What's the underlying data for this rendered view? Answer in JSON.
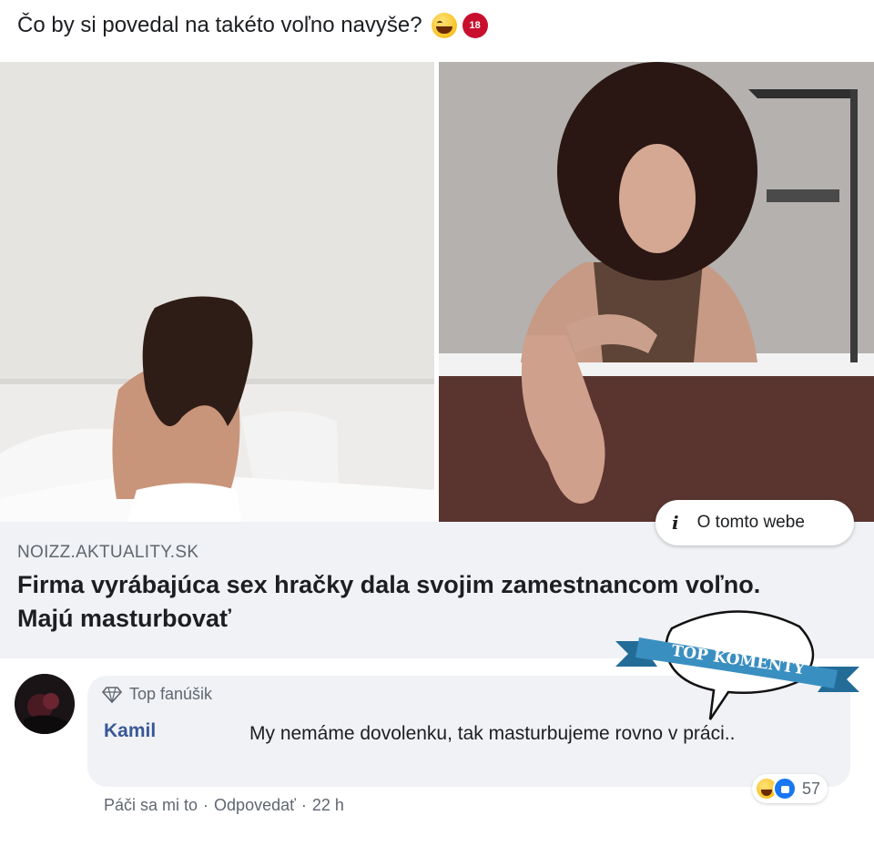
{
  "post": {
    "text": "Čo by si povedal na takéto voľno navyše?",
    "emojis": [
      "grinning-face-sweat-icon",
      "eighteen-plus-icon"
    ],
    "eighteen_label": "18"
  },
  "link_preview": {
    "domain": "NOIZZ.AKTUALITY.SK",
    "headline": "Firma vyrábajúca sex hračky dala svojim zamestnancom voľno. Majú masturbovať",
    "about_label": "O tomto webe"
  },
  "overlay_badge": {
    "label": "TOP KOMENTY",
    "colors": {
      "ribbon": "#3a8fc1",
      "ribbon_dark": "#236c98",
      "bubble": "#ffffff"
    }
  },
  "comment": {
    "badge": "Top fanúšik",
    "author": "Kamil",
    "text": "My nemáme dovolenku, tak masturbujeme rovno v práci..",
    "reaction_count": "57",
    "actions": {
      "like": "Páči sa mi to",
      "reply": "Odpovedať",
      "time": "22 h",
      "separator": "·"
    }
  },
  "colors": {
    "meta_bg": "#f0f2f5",
    "author_link": "#385898",
    "secondary_text": "#606770"
  }
}
